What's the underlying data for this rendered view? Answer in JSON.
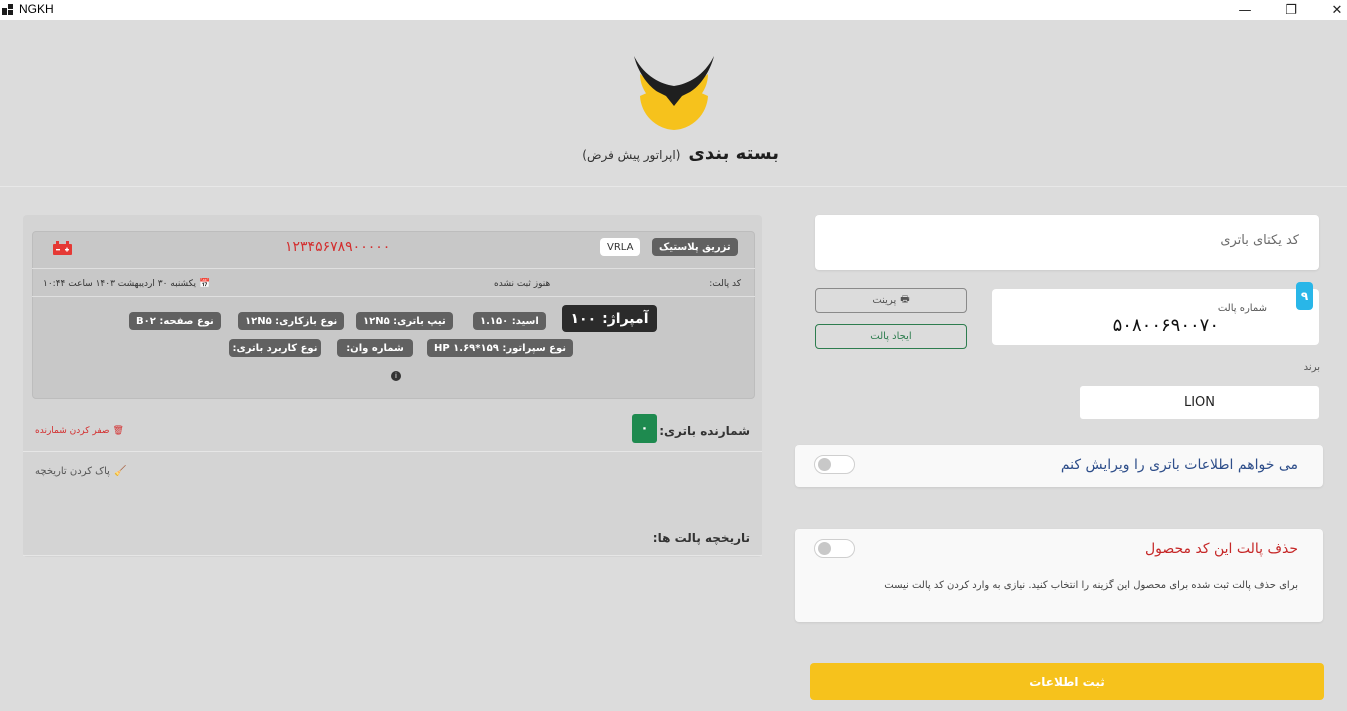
{
  "window": {
    "title": "NGKH",
    "minimize": "—",
    "maximize": "❐",
    "close": "✕"
  },
  "header": {
    "title": "بسته بندی",
    "operator": "(اپراتور پیش فرض)"
  },
  "form": {
    "battery_code_placeholder": "کد یکتای باتری",
    "pallet_label": "شماره پالت",
    "pallet_value": "۵۰۸۰۰۶۹۰۰۷۰",
    "pallet_badge": "۹",
    "print_label": "پرینت",
    "create_pallet_label": "ایجاد پالت",
    "brand_label": "برند",
    "brand_value": "LION",
    "edit_toggle_label": "می خواهم اطلاعات باتری را ویرایش کنم",
    "delete_toggle_label": "حذف پالت این کد محصول",
    "delete_description": "برای حذف پالت ثبت شده برای محصول این گزینه را انتخاب کنید. نیازی به وارد کردن کد پالت نیست",
    "submit_label": "ثبت اطلاعات"
  },
  "battery_info": {
    "tag_injection": "تزریق پلاستیک",
    "tag_type": "VRLA",
    "serial": "۱۲۳۴۵۶۷۸۹۰۰۰۰۰",
    "pallet_code_label": "کد پالت:",
    "pallet_code_status": "هنوز ثبت نشده",
    "datetime": "یکشنبه ۳۰ اردیبهشت ۱۴۰۳ ساعت ۱۰:۴۴",
    "amp_label": "آمپراژ:",
    "amp_value": "۱۰۰",
    "acid": "اسید:  ۱.۱۵۰",
    "battery_tape": "تیپ باتری:  ۱۲N۵",
    "opener_type": "نوع بازکاری:  ۱۲N۵",
    "plate_type": "نوع صفحه:  B۰۲",
    "separator_type": "نوع سپراتور:  HP ۱.۶۹*۱۵۹",
    "van_number": "شماره وان:",
    "usage_type": "نوع کاربرد باتری:"
  },
  "counter": {
    "label": "شمارنده باتری:",
    "value": "۰",
    "reset_label": "صفر کردن شمارنده"
  },
  "history": {
    "clear_label": "پاک کردن تاریخچه",
    "title": "تاریخچه پالت ها:"
  },
  "colors": {
    "accent_yellow": "#f6c21c",
    "danger_red": "#d32f2f",
    "success_green": "#1e8a4f",
    "info_blue": "#29b6e8"
  }
}
